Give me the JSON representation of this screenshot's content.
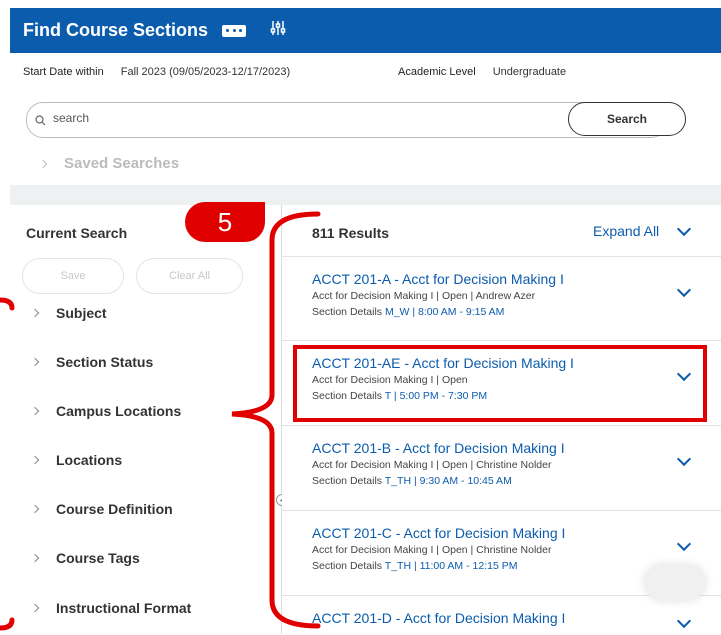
{
  "header": {
    "title": "Find Course Sections"
  },
  "criteria": {
    "start_date_label": "Start Date within",
    "start_date_value": "Fall 2023 (09/05/2023-12/17/2023)",
    "academic_level_label": "Academic Level",
    "academic_level_value": "Undergraduate"
  },
  "search": {
    "placeholder": "search",
    "button_label": "Search",
    "saved_searches": "Saved Searches"
  },
  "sidebar": {
    "title": "Current Search",
    "save_label": "Save",
    "clear_label": "Clear All",
    "facets": [
      "Subject",
      "Section Status",
      "Campus Locations",
      "Locations",
      "Course Definition",
      "Course Tags",
      "Instructional Format"
    ]
  },
  "results": {
    "count_label": "811 Results",
    "expand_all": "Expand All",
    "items": [
      {
        "title": "ACCT 201-A - Acct for Decision Making I",
        "subtitle": "Acct for Decision Making I  |  Open  |  Andrew Azer",
        "details_label": "Section Details",
        "schedule": "M_W | 8:00 AM - 9:15 AM"
      },
      {
        "title": "ACCT 201-AE - Acct for Decision Making I",
        "subtitle": "Acct for Decision Making I  |  Open",
        "details_label": "Section Details",
        "schedule": "T | 5:00 PM - 7:30 PM"
      },
      {
        "title": "ACCT 201-B - Acct for Decision Making I",
        "subtitle": "Acct for Decision Making I  |  Open  |  Christine Nolder",
        "details_label": "Section Details",
        "schedule": "T_TH | 9:30 AM - 10:45 AM"
      },
      {
        "title": "ACCT 201-C - Acct for Decision Making I",
        "subtitle": "Acct for Decision Making I  |  Open  |  Christine Nolder",
        "details_label": "Section Details",
        "schedule": "T_TH | 11:00 AM - 12:15 PM"
      },
      {
        "title": "ACCT 201-D - Acct for Decision Making I",
        "subtitle": "",
        "details_label": "",
        "schedule": ""
      }
    ]
  },
  "annotation": {
    "step_number": "5",
    "color": "#e00000"
  },
  "colors": {
    "header_bg": "#0b5cad",
    "link": "#0b5cad"
  }
}
